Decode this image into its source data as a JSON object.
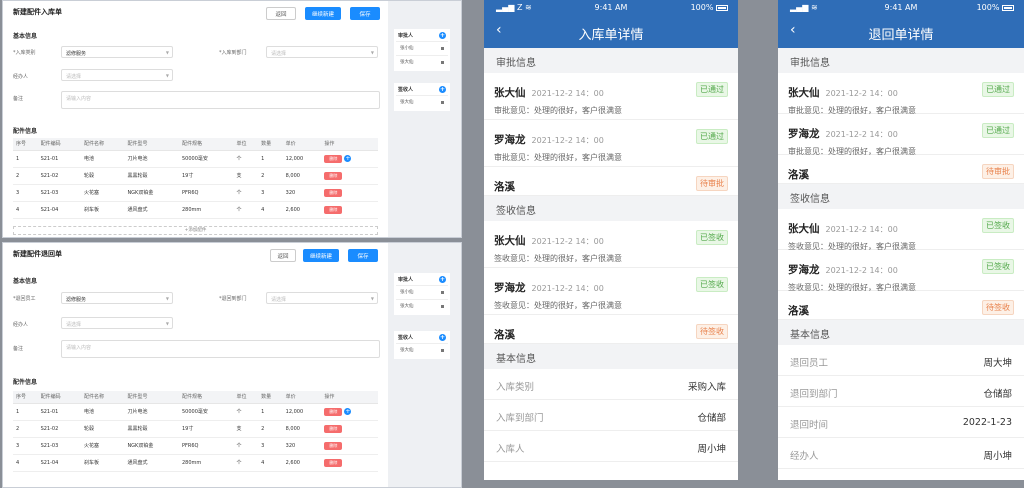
{
  "form1": {
    "title": "新建配件入库单",
    "buttons": {
      "back": "返回",
      "continue": "继续新建",
      "save": "保存"
    },
    "basic_section": "基本信息",
    "fields": {
      "type_label": "*入库类别",
      "type_value": "滤修服务",
      "dept_label": "*入库到部门",
      "dept_placeholder": "请选择",
      "handler_label": "经办人",
      "handler_placeholder": "请选择",
      "note_label": "备注",
      "note_placeholder": "请输入内容"
    },
    "parts_section": "配件信息",
    "add_row": "+添加配件",
    "side": {
      "approver_title": "审批人",
      "approvers": [
        "张小仙",
        "张大仙"
      ],
      "receiver_title": "签收人",
      "receivers": [
        "张大仙"
      ]
    }
  },
  "form2": {
    "title": "新建配件退回单",
    "buttons": {
      "back": "返回",
      "continue": "继续新建",
      "save": "保存"
    },
    "basic_section": "基本信息",
    "fields": {
      "type_label": "*退回员工",
      "type_value": "滤修服务",
      "dept_label": "*退回到部门",
      "dept_placeholder": "请选择",
      "handler_label": "经办人",
      "handler_placeholder": "请选择",
      "note_label": "备注",
      "note_placeholder": "请输入内容"
    },
    "parts_section": "配件信息",
    "side": {
      "approver_title": "审批人",
      "approvers": [
        "张小仙",
        "张大仙"
      ],
      "receiver_title": "签收人",
      "receivers": [
        "张大仙"
      ]
    }
  },
  "parts_table": {
    "headers": [
      "序号",
      "配件编码",
      "配件名称",
      "配件型号",
      "配件规格",
      "单位",
      "数量",
      "单价",
      "操作"
    ],
    "rows": [
      [
        "1",
        "S21-01",
        "电池",
        "刀片电池",
        "50000毫安",
        "个",
        "1",
        "12,000"
      ],
      [
        "2",
        "S21-02",
        "轮毂",
        "黑黑轮毂",
        "19寸",
        "支",
        "2",
        "8,000"
      ],
      [
        "3",
        "S21-03",
        "火花塞",
        "NGK双铂金",
        "PFR6Q",
        "个",
        "3",
        "320"
      ],
      [
        "4",
        "S21-04",
        "刹车板",
        "通风盘式",
        "280mm",
        "个",
        "4",
        "2,600"
      ]
    ],
    "delete_label": "删除"
  },
  "mobile1": {
    "status": {
      "carrier": "Z",
      "time": "9:41 AM",
      "battery": "100%"
    },
    "title": "入库单详情",
    "approval_section": "审批信息",
    "approvals": [
      {
        "name": "张大仙",
        "date": "2021-12-2  14：00",
        "status": "已通过",
        "comment": "审批意见：处理的很好，客户很满意"
      },
      {
        "name": "罗海龙",
        "date": "2021-12-2  14：00",
        "status": "已通过",
        "comment": "审批意见：处理的很好，客户很满意"
      },
      {
        "name": "洛溪",
        "date": "",
        "status": "待审批",
        "comment": ""
      }
    ],
    "receipt_section": "签收信息",
    "receipts": [
      {
        "name": "张大仙",
        "date": "2021-12-2  14：00",
        "status": "已签收",
        "comment": "签收意见：处理的很好，客户很满意"
      },
      {
        "name": "罗海龙",
        "date": "2021-12-2  14：00",
        "status": "已签收",
        "comment": "签收意见：处理的很好，客户很满意"
      },
      {
        "name": "洛溪",
        "date": "",
        "status": "待签收",
        "comment": ""
      }
    ],
    "basic_section": "基本信息",
    "basic": [
      {
        "k": "入库类别",
        "v": "采购入库"
      },
      {
        "k": "入库到部门",
        "v": "仓储部"
      },
      {
        "k": "入库人",
        "v": "周小坤"
      }
    ]
  },
  "mobile2": {
    "status": {
      "carrier": "",
      "time": "9:41 AM",
      "battery": "100%"
    },
    "title": "退回单详情",
    "approval_section": "审批信息",
    "approvals": [
      {
        "name": "张大仙",
        "date": "2021-12-2  14：00",
        "status": "已通过",
        "comment": "审批意见：处理的很好，客户很满意"
      },
      {
        "name": "罗海龙",
        "date": "2021-12-2  14：00",
        "status": "已通过",
        "comment": "审批意见：处理的很好，客户很满意"
      },
      {
        "name": "洛溪",
        "date": "",
        "status": "待审批",
        "comment": ""
      }
    ],
    "receipt_section": "签收信息",
    "receipts": [
      {
        "name": "张大仙",
        "date": "2021-12-2  14：00",
        "status": "已签收",
        "comment": "签收意见：处理的很好，客户很满意"
      },
      {
        "name": "罗海龙",
        "date": "2021-12-2  14：00",
        "status": "已签收",
        "comment": "签收意见：处理的很好，客户很满意"
      },
      {
        "name": "洛溪",
        "date": "",
        "status": "待签收",
        "comment": ""
      }
    ],
    "basic_section": "基本信息",
    "basic": [
      {
        "k": "退回员工",
        "v": "周大坤"
      },
      {
        "k": "退回到部门",
        "v": "仓储部"
      },
      {
        "k": "退回时间",
        "v": "2022-1-23"
      },
      {
        "k": "经办人",
        "v": "周小坤"
      }
    ]
  },
  "colors": {
    "accent": "#1a8cff",
    "mobile_header": "#2f6db7",
    "ok": "#52a84a",
    "wait": "#e8804a",
    "danger": "#f56c6c"
  }
}
